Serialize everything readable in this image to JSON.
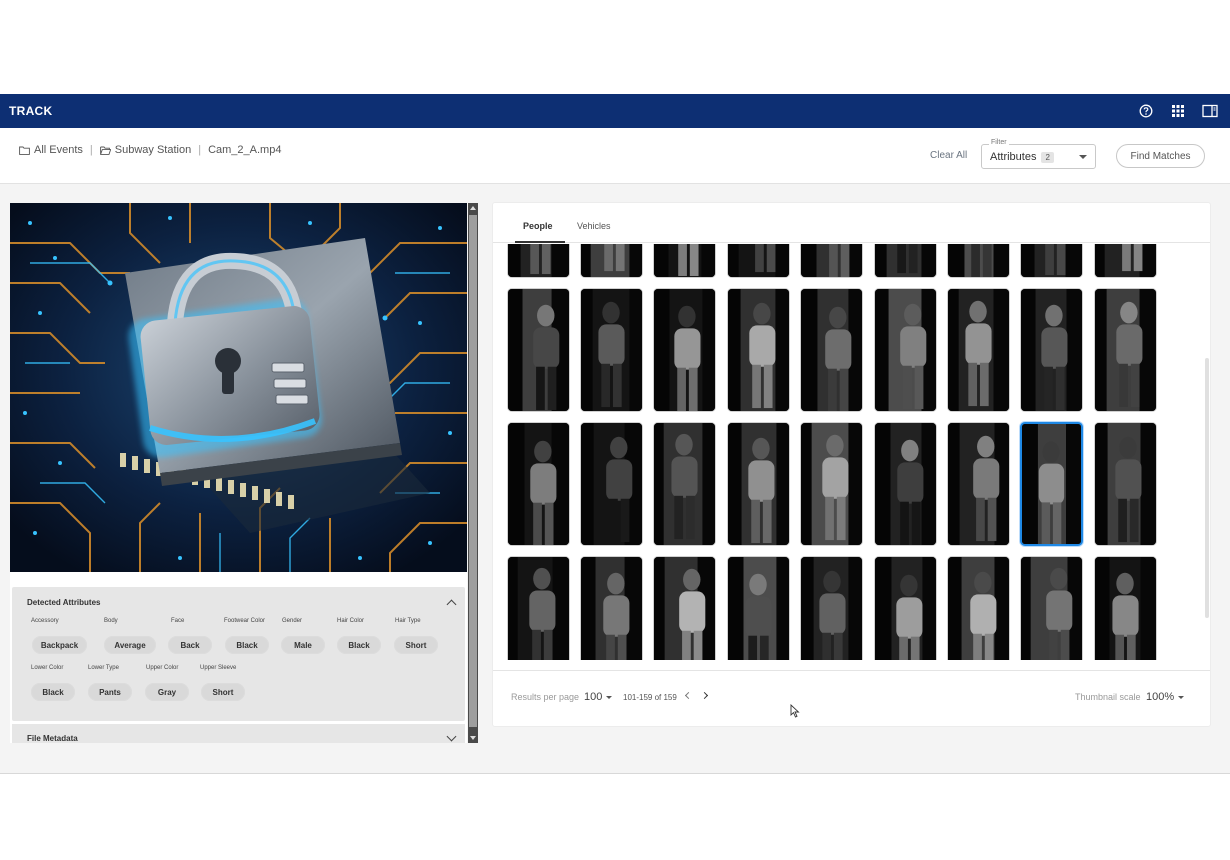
{
  "app": {
    "title": "TRACK"
  },
  "topbar": {
    "icons": [
      "help-icon",
      "apps-grid-icon",
      "side-panel-icon"
    ]
  },
  "breadcrumb": {
    "items": [
      {
        "label": "All Events",
        "icon": "folder-icon"
      },
      {
        "label": "Subway Station",
        "icon": "folder-open-icon"
      },
      {
        "label": "Cam_2_A.mp4",
        "icon": ""
      }
    ],
    "separator": "|"
  },
  "toolbar": {
    "clear_all": "Clear All",
    "filter_legend": "Filter",
    "filter_value": "Attributes",
    "filter_count": "2",
    "find_matches": "Find Matches"
  },
  "detected_attributes": {
    "title": "Detected Attributes",
    "row1": [
      {
        "label": "Accessory",
        "value": "Backpack"
      },
      {
        "label": "Body",
        "value": "Average"
      },
      {
        "label": "Face",
        "value": "Back"
      },
      {
        "label": "Footwear Color",
        "value": "Black"
      },
      {
        "label": "Gender",
        "value": "Male"
      },
      {
        "label": "Hair Color",
        "value": "Black"
      },
      {
        "label": "Hair Type",
        "value": "Short"
      }
    ],
    "row2": [
      {
        "label": "Lower Color",
        "value": "Black"
      },
      {
        "label": "Lower Type",
        "value": "Pants"
      },
      {
        "label": "Upper Color",
        "value": "Gray"
      },
      {
        "label": "Upper Sleeve",
        "value": "Short"
      }
    ]
  },
  "file_metadata": {
    "title": "File Metadata"
  },
  "results": {
    "tabs": [
      "People",
      "Vehicles"
    ],
    "active_tab": "People",
    "selected_index": 25,
    "rows_visible": 5,
    "cols": 9
  },
  "footer": {
    "results_per_page_label": "Results per page",
    "results_per_page": "100",
    "range": "101-159 of 159",
    "thumbnail_scale_label": "Thumbnail scale",
    "thumbnail_scale": "100%"
  },
  "colors": {
    "topbar": "#0d2f73",
    "selection": "#1e88e5",
    "preview_glow": "#37c3ff",
    "circuit": "#d18a2a"
  }
}
